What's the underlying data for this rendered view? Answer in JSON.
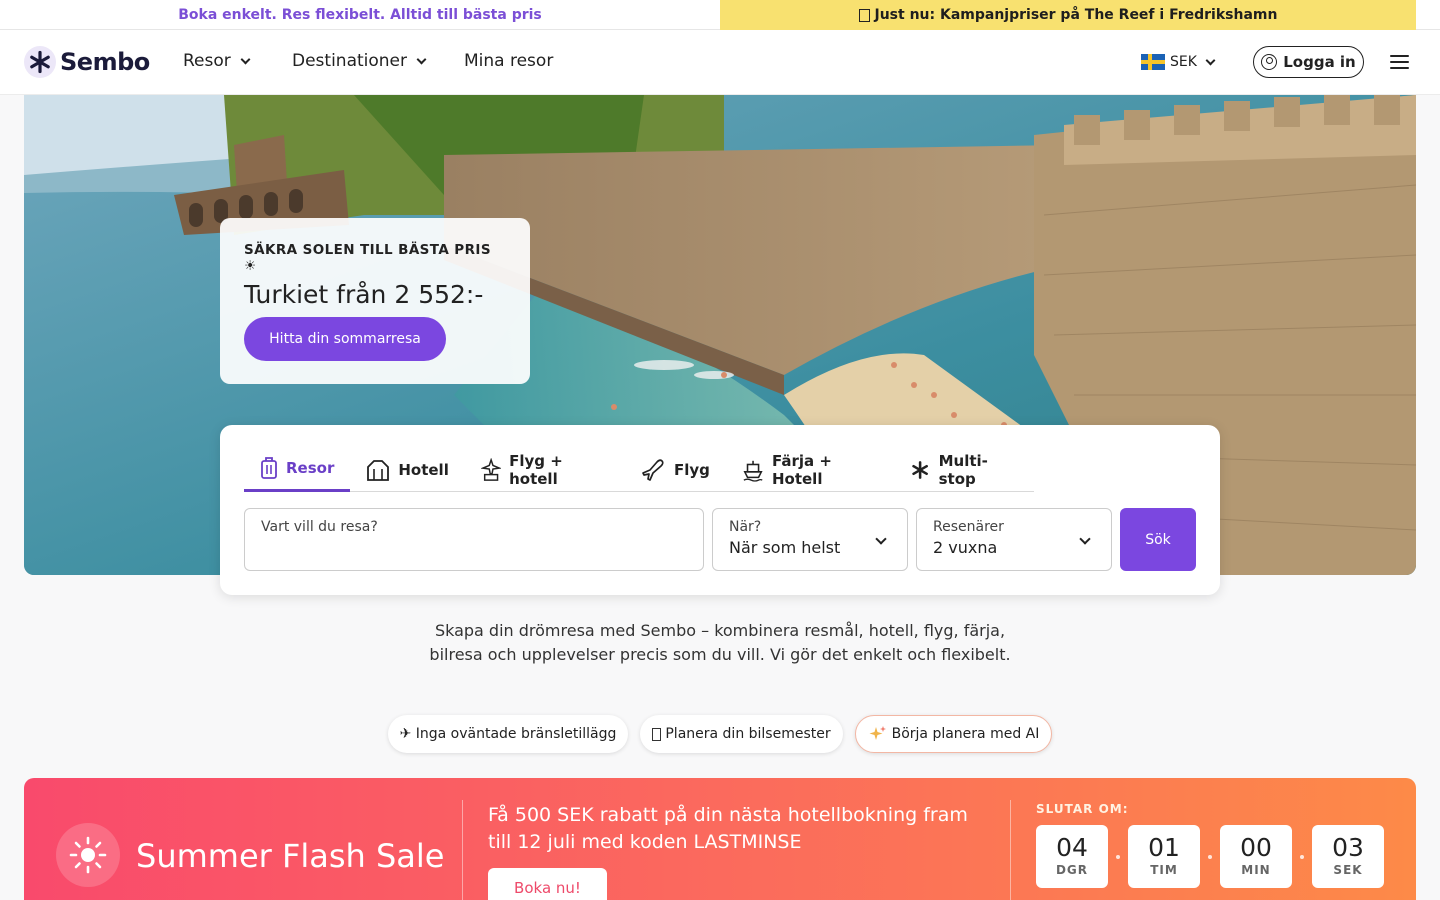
{
  "topbar": {
    "left_text": "Boka enkelt. Res flexibelt. Alltid till bästa pris",
    "right_text": "Just nu: Kampanjpriser på The Reef i Fredrikshamn",
    "right_icon": "gift-icon"
  },
  "header": {
    "logo_text": "Sembo",
    "nav": [
      {
        "label": "Resor",
        "dropdown": true
      },
      {
        "label": "Destinationer",
        "dropdown": true
      },
      {
        "label": "Mina resor",
        "dropdown": false
      }
    ],
    "currency": "SEK",
    "currency_flag": "sweden-flag-icon",
    "login_label": "Logga in",
    "menu_icon": "hamburger-menu-icon"
  },
  "hero": {
    "kicker": "SÄKRA SOLEN TILL BÄSTA PRIS ☀",
    "title": "Turkiet från 2 552:-",
    "cta": "Hitta din sommarresa",
    "slides": {
      "count": 3,
      "active": 2
    },
    "colors": {
      "sea": "#3c8ea0",
      "wall": "#a98e6c",
      "foliage": "#5a7a32"
    }
  },
  "search": {
    "tabs": [
      {
        "label": "Resor",
        "icon": "suitcase-icon",
        "active": true
      },
      {
        "label": "Hotell",
        "icon": "hotel-icon",
        "active": false
      },
      {
        "label": "Flyg + hotell",
        "icon": "flight-hotel-icon",
        "active": false
      },
      {
        "label": "Flyg",
        "icon": "plane-icon",
        "active": false
      },
      {
        "label": "Färja + Hotell",
        "icon": "ferry-icon",
        "active": false
      },
      {
        "label": "Multi-stop",
        "icon": "sembo-star-icon",
        "active": false
      }
    ],
    "destination": {
      "label": "Vart vill du resa?",
      "value": ""
    },
    "when": {
      "label": "När?",
      "value": "När som helst"
    },
    "travellers": {
      "label": "Resenärer",
      "value": "2 vuxna"
    },
    "submit": "Sök"
  },
  "intro_text": "Skapa din drömresa med Sembo – kombinera resmål, hotell, flyg, färja, bilresa och upplevelser precis som du vill. Vi gör det enkelt och flexibelt.",
  "chips": [
    {
      "label": "✈ Inga oväntade bränsletillägg",
      "icon": "plane-icon"
    },
    {
      "label": "Planera din bilsemester",
      "icon": "car-icon"
    },
    {
      "label": "Börja planera med AI",
      "icon": "sparkle-icon"
    }
  ],
  "flash_sale": {
    "title": "Summer Flash Sale",
    "message": "Få 500 SEK rabatt på din nästa hotellbokning fram till 12 juli med koden LASTMINSE",
    "cta": "Boka nu!",
    "ends_label": "SLUTAR OM:",
    "countdown": [
      {
        "value": "04",
        "unit": "DGR"
      },
      {
        "value": "01",
        "unit": "TIM"
      },
      {
        "value": "00",
        "unit": "MIN"
      },
      {
        "value": "03",
        "unit": "SEK"
      }
    ],
    "gradient": [
      "#f94a6c",
      "#fd8a48"
    ]
  }
}
